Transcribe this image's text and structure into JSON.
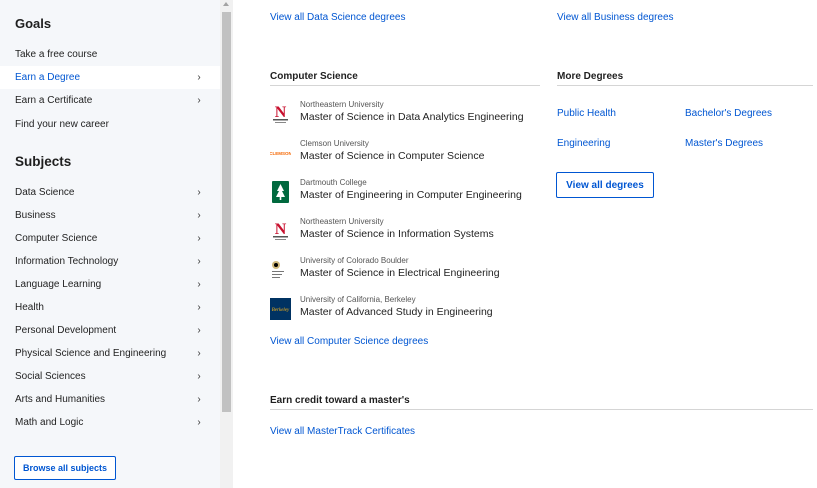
{
  "sidebar": {
    "goals_heading": "Goals",
    "goals": [
      {
        "label": "Take a free course",
        "chevron": false,
        "active": false
      },
      {
        "label": "Earn a Degree",
        "chevron": true,
        "active": true
      },
      {
        "label": "Earn a Certificate",
        "chevron": true,
        "active": false
      },
      {
        "label": "Find your new career",
        "chevron": false,
        "active": false
      }
    ],
    "subjects_heading": "Subjects",
    "subjects": [
      "Data Science",
      "Business",
      "Computer Science",
      "Information Technology",
      "Language Learning",
      "Health",
      "Personal Development",
      "Physical Science and Engineering",
      "Social Sciences",
      "Arts and Humanities",
      "Math and Logic"
    ],
    "chevron_glyph": "›",
    "browse_label": "Browse all subjects"
  },
  "main": {
    "top_links": {
      "data_science": "View all Data Science degrees",
      "business": "View all Business degrees"
    },
    "computer_science": {
      "title": "Computer Science",
      "degrees": [
        {
          "university": "Northeastern University",
          "program": "Master of Science in Data Analytics Engineering",
          "logo": "northeastern-logo"
        },
        {
          "university": "Clemson University",
          "program": "Master of Science in Computer Science",
          "logo": "clemson-logo"
        },
        {
          "university": "Dartmouth College",
          "program": "Master of Engineering in Computer Engineering",
          "logo": "dartmouth-logo"
        },
        {
          "university": "Northeastern University",
          "program": "Master of Science in Information Systems",
          "logo": "northeastern-logo"
        },
        {
          "university": "University of Colorado Boulder",
          "program": "Master of Science in Electrical Engineering",
          "logo": "cu-boulder-logo"
        },
        {
          "university": "University of California, Berkeley",
          "program": "Master of Advanced Study in Engineering",
          "logo": "berkeley-logo"
        }
      ],
      "view_all": "View all Computer Science degrees"
    },
    "more_degrees": {
      "title": "More Degrees",
      "links": [
        "Public Health",
        "Bachelor's Degrees",
        "Engineering",
        "Master's Degrees"
      ],
      "button": "View all degrees"
    },
    "mastertrack": {
      "title": "Earn credit toward a master's",
      "link": "View all MasterTrack Certificates"
    }
  },
  "colors": {
    "accent": "#0056d2",
    "sidebar_bg": "#f5f7fa",
    "northeastern_red": "#c8102e",
    "dartmouth_green": "#00693e",
    "clemson_orange": "#f56600",
    "berkeley_blue": "#003262",
    "cu_gold": "#cfb87c"
  }
}
